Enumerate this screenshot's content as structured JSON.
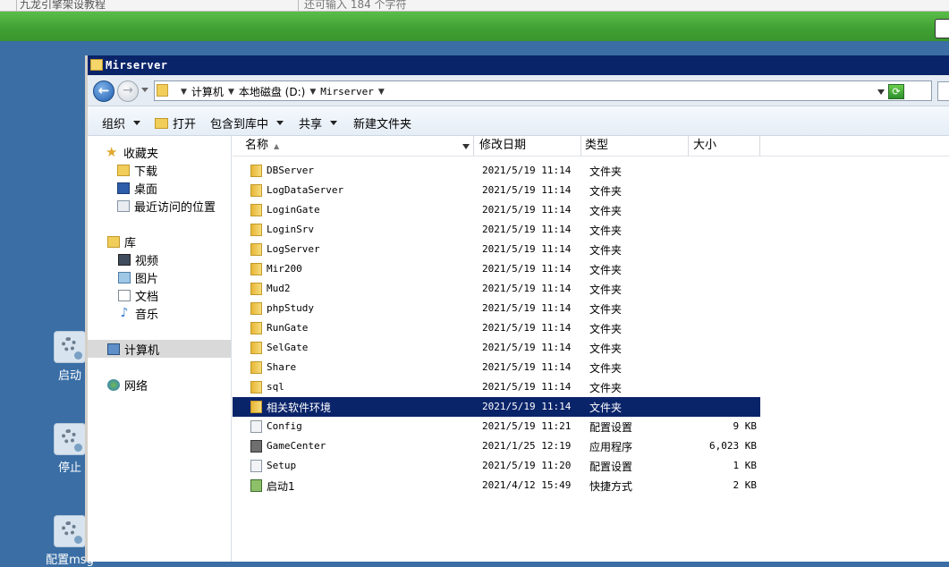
{
  "top_strip": {
    "left_text": "九龙引擎架设教程",
    "right_text": "还可输入 184 个字符"
  },
  "desktop_icons": [
    {
      "label": "启动"
    },
    {
      "label": "停止"
    },
    {
      "label": "配置msg"
    }
  ],
  "window": {
    "title": "Mirserver",
    "breadcrumbs": [
      "计算机",
      "本地磁盘 (D:)",
      "Mirserver"
    ]
  },
  "toolbar": {
    "organize": "组织",
    "open": "打开",
    "include_library": "包含到库中",
    "share": "共享",
    "new_folder": "新建文件夹"
  },
  "nav": {
    "favorites": "收藏夹",
    "downloads": "下载",
    "desktop": "桌面",
    "recent": "最近访问的位置",
    "libraries": "库",
    "videos": "视频",
    "pictures": "图片",
    "documents": "文档",
    "music": "音乐",
    "computer": "计算机",
    "network": "网络"
  },
  "columns": {
    "name": "名称",
    "date": "修改日期",
    "type": "类型",
    "size": "大小"
  },
  "files": [
    {
      "name": "DBServer",
      "date": "2021/5/19 11:14",
      "type": "文件夹",
      "size": "",
      "icon": "folder-icon"
    },
    {
      "name": "LogDataServer",
      "date": "2021/5/19 11:14",
      "type": "文件夹",
      "size": "",
      "icon": "folder-icon"
    },
    {
      "name": "LoginGate",
      "date": "2021/5/19 11:14",
      "type": "文件夹",
      "size": "",
      "icon": "folder-icon"
    },
    {
      "name": "LoginSrv",
      "date": "2021/5/19 11:14",
      "type": "文件夹",
      "size": "",
      "icon": "folder-icon"
    },
    {
      "name": "LogServer",
      "date": "2021/5/19 11:14",
      "type": "文件夹",
      "size": "",
      "icon": "folder-icon"
    },
    {
      "name": "Mir200",
      "date": "2021/5/19 11:14",
      "type": "文件夹",
      "size": "",
      "icon": "folder-icon"
    },
    {
      "name": "Mud2",
      "date": "2021/5/19 11:14",
      "type": "文件夹",
      "size": "",
      "icon": "folder-icon"
    },
    {
      "name": "phpStudy",
      "date": "2021/5/19 11:14",
      "type": "文件夹",
      "size": "",
      "icon": "folder-icon"
    },
    {
      "name": "RunGate",
      "date": "2021/5/19 11:14",
      "type": "文件夹",
      "size": "",
      "icon": "folder-icon"
    },
    {
      "name": "SelGate",
      "date": "2021/5/19 11:14",
      "type": "文件夹",
      "size": "",
      "icon": "folder-icon"
    },
    {
      "name": "Share",
      "date": "2021/5/19 11:14",
      "type": "文件夹",
      "size": "",
      "icon": "folder-icon"
    },
    {
      "name": "sql",
      "date": "2021/5/19 11:14",
      "type": "文件夹",
      "size": "",
      "icon": "folder-icon"
    },
    {
      "name": "相关软件环境",
      "date": "2021/5/19 11:14",
      "type": "文件夹",
      "size": "",
      "icon": "folder-icon",
      "selected": true
    },
    {
      "name": "Config",
      "date": "2021/5/19 11:21",
      "type": "配置设置",
      "size": "9 KB",
      "icon": "config-file-icon"
    },
    {
      "name": "GameCenter",
      "date": "2021/1/25 12:19",
      "type": "应用程序",
      "size": "6,023 KB",
      "icon": "application-icon"
    },
    {
      "name": "Setup",
      "date": "2021/5/19 11:20",
      "type": "配置设置",
      "size": "1 KB",
      "icon": "config-file-icon"
    },
    {
      "name": "启动1",
      "date": "2021/4/12 15:49",
      "type": "快捷方式",
      "size": "2 KB",
      "icon": "shortcut-icon"
    }
  ]
}
